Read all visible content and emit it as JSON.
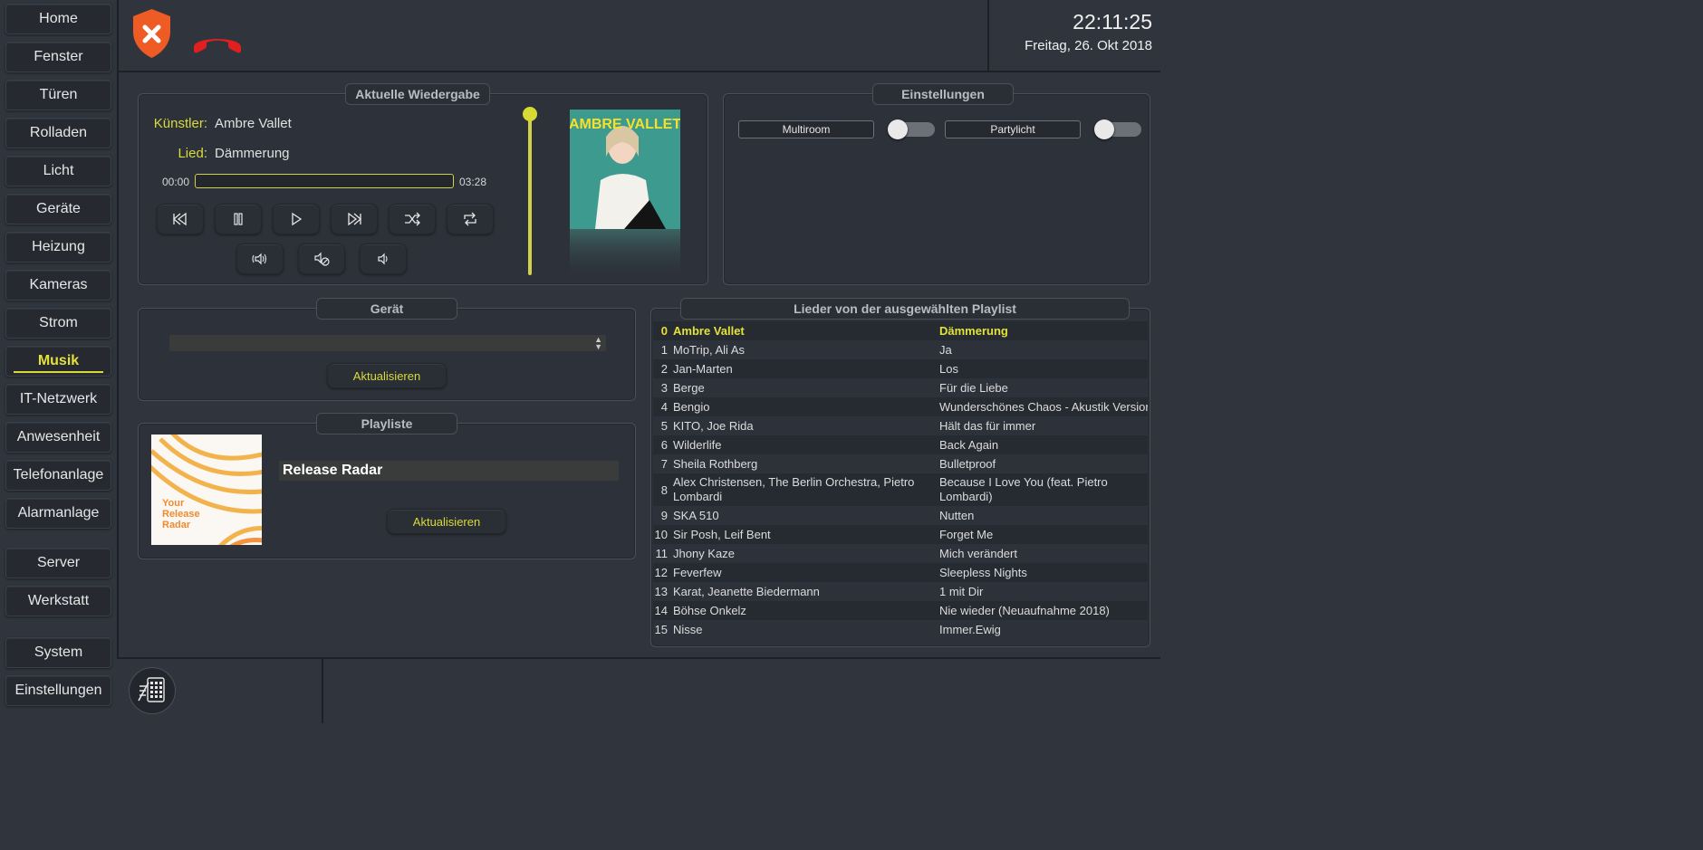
{
  "sidebar": {
    "items": [
      {
        "label": "Home"
      },
      {
        "label": "Fenster"
      },
      {
        "label": "Türen"
      },
      {
        "label": "Rolladen"
      },
      {
        "label": "Licht"
      },
      {
        "label": "Geräte"
      },
      {
        "label": "Heizung"
      },
      {
        "label": "Kameras"
      },
      {
        "label": "Strom"
      },
      {
        "label": "Musik",
        "active": true
      },
      {
        "label": "IT-Netzwerk"
      },
      {
        "label": "Anwesenheit"
      },
      {
        "label": "Telefonanlage"
      },
      {
        "label": "Alarmanlage"
      },
      {
        "label": "Server"
      },
      {
        "label": "Werkstatt"
      },
      {
        "label": "System"
      },
      {
        "label": "Einstellungen"
      }
    ]
  },
  "header": {
    "time": "22:11:25",
    "date": "Freitag, 26. Okt 2018",
    "status_icons": [
      "shield-alarm-icon",
      "phone-hangup-icon"
    ]
  },
  "now_playing": {
    "title": "Aktuelle Wiedergabe",
    "artist_label": "Künstler:",
    "artist": "Ambre Vallet",
    "song_label": "Lied:",
    "song": "Dämmerung",
    "time_current": "00:00",
    "time_total": "03:28",
    "progress": 0,
    "volume": 1.0,
    "cover_text": "AMBRE VALLET",
    "controls": [
      "rewind-icon",
      "pause-icon",
      "play-icon",
      "forward-icon",
      "shuffle-icon",
      "repeat-icon"
    ],
    "volume_controls": [
      "volume-up-icon",
      "mute-icon",
      "volume-down-icon"
    ]
  },
  "settings": {
    "title": "Einstellungen",
    "toggles": [
      {
        "label": "Multiroom",
        "on": false
      },
      {
        "label": "Partylicht",
        "on": false
      }
    ]
  },
  "device": {
    "title": "Gerät",
    "selected": "",
    "refresh_label": "Aktualisieren"
  },
  "playlist": {
    "title": "Playliste",
    "name": "Release Radar",
    "cover_text": "Your Release Radar",
    "refresh_label": "Aktualisieren"
  },
  "songs": {
    "title": "Lieder von der ausgewählten Playlist",
    "rows": [
      {
        "num": "0",
        "artist": "Ambre Vallet",
        "title": "Dämmerung"
      },
      {
        "num": "1",
        "artist": "MoTrip, Ali As",
        "title": "Ja"
      },
      {
        "num": "2",
        "artist": "Jan-Marten",
        "title": "Los"
      },
      {
        "num": "3",
        "artist": "Berge",
        "title": "Für die Liebe"
      },
      {
        "num": "4",
        "artist": "Bengio",
        "title": "Wunderschönes Chaos - Akustik Version"
      },
      {
        "num": "5",
        "artist": "KITO, Joe Rida",
        "title": "Hält das für immer"
      },
      {
        "num": "6",
        "artist": "Wilderlife",
        "title": "Back Again"
      },
      {
        "num": "7",
        "artist": "Sheila Rothberg",
        "title": "Bulletproof"
      },
      {
        "num": "8",
        "artist": "Alex Christensen, The Berlin Orchestra, Pietro Lombardi",
        "title": "Because I Love You (feat. Pietro Lombardi)"
      },
      {
        "num": "9",
        "artist": "SKA 510",
        "title": "Nutten"
      },
      {
        "num": "10",
        "artist": "Sir Posh, Leif Bent",
        "title": "Forget Me"
      },
      {
        "num": "11",
        "artist": "Jhony Kaze",
        "title": "Mich verändert"
      },
      {
        "num": "12",
        "artist": "Feverfew",
        "title": "Sleepless Nights"
      },
      {
        "num": "13",
        "artist": "Karat, Jeanette Biedermann",
        "title": "1 mit Dir"
      },
      {
        "num": "14",
        "artist": "Böhse Onkelz",
        "title": "Nie wieder (Neuaufnahme 2018)"
      },
      {
        "num": "15",
        "artist": "Nisse",
        "title": "Immer.Ewig"
      }
    ]
  },
  "footer": {
    "icon": "keypad-icon"
  }
}
